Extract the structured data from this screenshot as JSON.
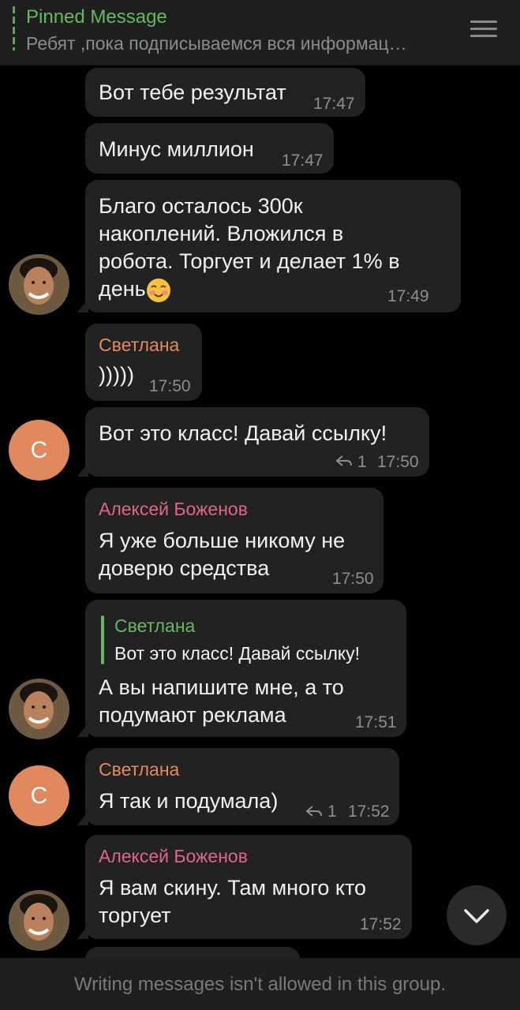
{
  "pinned": {
    "title": "Pinned Message",
    "text": "Ребят ,пока подписываемся вся информац…"
  },
  "messages": [
    {
      "text": "Вот тебе результат",
      "time": "17:47"
    },
    {
      "text": "Минус миллион",
      "time": "17:47"
    },
    {
      "lines": [
        "Благо осталось 300к",
        "накоплений. Вложился в",
        "робота. Торгует и делает 1% в",
        "день"
      ],
      "time": "17:49"
    },
    {
      "sender": "Светлана",
      "text": ")))))",
      "time": "17:50"
    },
    {
      "text": "Вот это класс! Давай ссылку!",
      "replies": "1",
      "time": "17:50"
    },
    {
      "sender": "Алексей Боженов",
      "lines": [
        "Я уже больше никому не",
        "доверю средства"
      ],
      "time": "17:50"
    },
    {
      "quote_name": "Светлана",
      "quote_text": "Вот это класс! Давай ссылку!",
      "lines": [
        "А вы напишите мне, а то",
        "подумают реклама"
      ],
      "time": "17:51"
    },
    {
      "sender": "Светлана",
      "text": "Я так и подумала)",
      "replies": "1",
      "time": "17:52"
    },
    {
      "sender": "Алексей Боженов",
      "lines": [
        "Я вам скину. Там много кто",
        "торгует"
      ],
      "time": "17:52"
    }
  ],
  "avatars": {
    "letter": "С"
  },
  "bottom_bar": {
    "text": "Writing messages isn't allowed in this group."
  },
  "colors": {
    "background": "#000000",
    "bubble": "#222222",
    "accent_green": "#66b95e",
    "name_orange": "#e58a5e",
    "name_pink": "#e06687",
    "avatar_orange": "#e0895f"
  },
  "icons": [
    "menu-icon",
    "reply-icon",
    "chevron-down-icon",
    "smiling-face-emoji"
  ]
}
